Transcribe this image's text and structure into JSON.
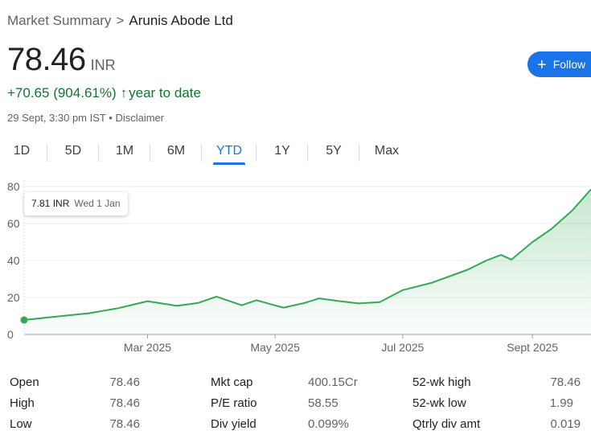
{
  "breadcrumb": {
    "parent": "Market Summary",
    "separator": ">",
    "company": "Arunis Abode Ltd"
  },
  "price": {
    "value": "78.46",
    "currency": "INR"
  },
  "change": {
    "text": "+70.65 (904.61%)",
    "arrow": "↑",
    "period": "year to date"
  },
  "timestamp": {
    "time": "29 Sept, 3:30 pm IST",
    "bullet": "•",
    "disclaimer": "Disclaimer"
  },
  "follow_button": {
    "label": "Follow",
    "icon": "plus-icon"
  },
  "tabs": [
    {
      "label": "1D"
    },
    {
      "label": "5D"
    },
    {
      "label": "1M"
    },
    {
      "label": "6M"
    },
    {
      "label": "YTD",
      "active": true
    },
    {
      "label": "1Y"
    },
    {
      "label": "5Y"
    },
    {
      "label": "Max"
    }
  ],
  "tooltip": {
    "value": "7.81 INR",
    "date": "Wed 1 Jan"
  },
  "colors": {
    "accent": "#1a73e8",
    "up": "#137333",
    "line": "#34a853"
  },
  "chart_data": {
    "type": "area",
    "ylim": [
      0,
      80
    ],
    "y_ticks": [
      "0",
      "20",
      "40",
      "60",
      "80"
    ],
    "x_ticks": [
      {
        "label": "Mar 2025",
        "date": "2025-03-01"
      },
      {
        "label": "May 2025",
        "date": "2025-05-01"
      },
      {
        "label": "Jul 2025",
        "date": "2025-07-01"
      },
      {
        "label": "Sept 2025",
        "date": "2025-09-01"
      }
    ],
    "x_range": [
      "2025-01-01",
      "2025-09-29"
    ],
    "series": [
      {
        "points": [
          [
            "2025-01-01",
            7.81
          ],
          [
            "2025-01-15",
            9.5
          ],
          [
            "2025-02-01",
            11.5
          ],
          [
            "2025-02-15",
            14.2
          ],
          [
            "2025-03-01",
            18
          ],
          [
            "2025-03-15",
            15.5
          ],
          [
            "2025-03-25",
            17
          ],
          [
            "2025-04-03",
            20.5
          ],
          [
            "2025-04-15",
            15.8
          ],
          [
            "2025-04-22",
            18.5
          ],
          [
            "2025-04-30",
            16
          ],
          [
            "2025-05-05",
            14.5
          ],
          [
            "2025-05-15",
            17
          ],
          [
            "2025-05-22",
            19.5
          ],
          [
            "2025-06-01",
            18
          ],
          [
            "2025-06-10",
            16.8
          ],
          [
            "2025-06-20",
            17.5
          ],
          [
            "2025-07-01",
            24
          ],
          [
            "2025-07-15",
            28
          ],
          [
            "2025-08-01",
            35
          ],
          [
            "2025-08-10",
            40
          ],
          [
            "2025-08-17",
            43
          ],
          [
            "2025-08-22",
            40.5
          ],
          [
            "2025-09-01",
            50
          ],
          [
            "2025-09-10",
            57
          ],
          [
            "2025-09-20",
            67
          ],
          [
            "2025-09-29",
            78.46
          ]
        ]
      }
    ]
  },
  "stats": [
    [
      {
        "label": "Open",
        "value": "78.46"
      },
      {
        "label": "Mkt cap",
        "value": "400.15Cr"
      },
      {
        "label": "52-wk high",
        "value": "78.46"
      }
    ],
    [
      {
        "label": "High",
        "value": "78.46"
      },
      {
        "label": "P/E ratio",
        "value": "58.55"
      },
      {
        "label": "52-wk low",
        "value": "1.99"
      }
    ],
    [
      {
        "label": "Low",
        "value": "78.46"
      },
      {
        "label": "Div yield",
        "value": "0.099%"
      },
      {
        "label": "Qtrly div amt",
        "value": "0.019"
      }
    ]
  ]
}
